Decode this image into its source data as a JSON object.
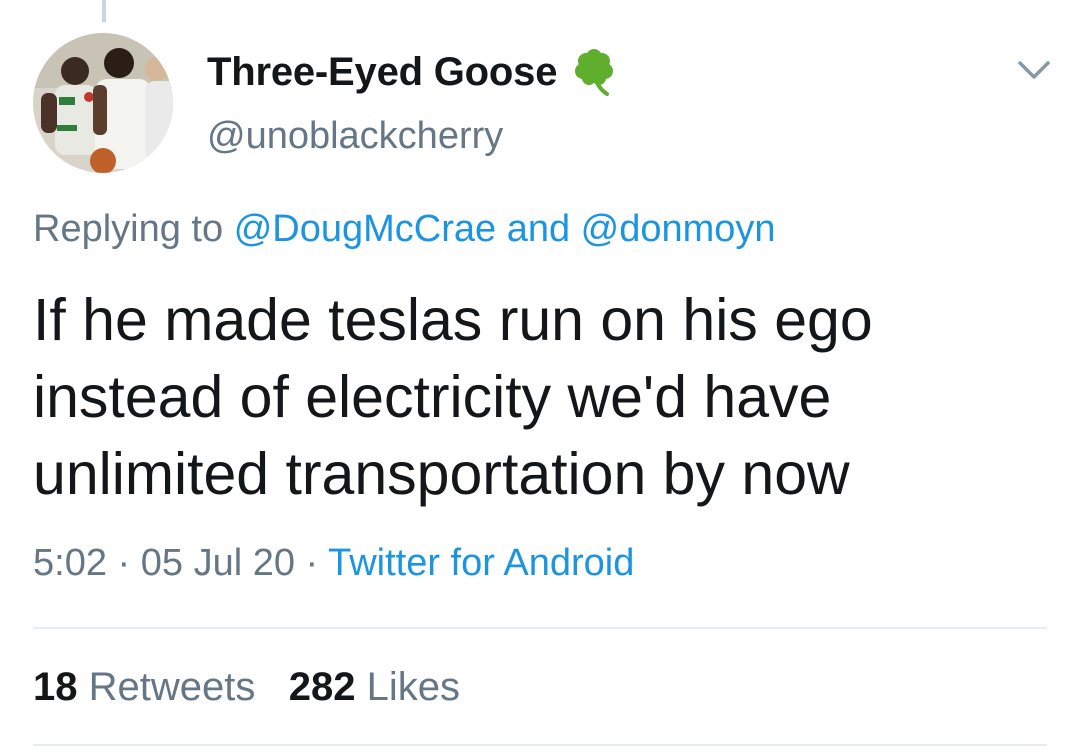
{
  "tweet": {
    "display_name": "Three-Eyed Goose",
    "handle": "@unoblackcherry",
    "name_emoji_icon": "shamrock-icon",
    "reply": {
      "prefix": "Replying to",
      "mention_1": "@DougMcCrae",
      "connector": "and",
      "mention_2": "@donmoyn"
    },
    "text": "If he made teslas run on his ego instead of electricity we'd have unlimited transportation by now",
    "time": "5:02",
    "separator": "·",
    "date": "05 Jul 20",
    "source": "Twitter for Android",
    "retweets_count": "18",
    "retweets_label": "Retweets",
    "likes_count": "282",
    "likes_label": "Likes"
  },
  "colors": {
    "link": "#1b95e0",
    "secondary_text": "#657786",
    "primary_text": "#14171a",
    "shamrock": "#5fae2e",
    "divider": "#e6ecf0"
  }
}
